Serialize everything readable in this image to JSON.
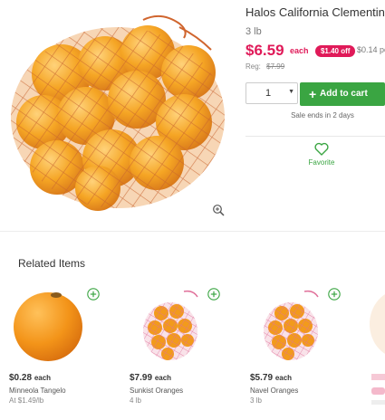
{
  "product": {
    "title": "Halos California Clementines",
    "size": "3 lb",
    "price": "$6.59",
    "each_label": "each",
    "discount_badge": "$1.40 off",
    "unit_price": "$0.14 pe",
    "reg_label": "Reg:",
    "reg_price": "$7.99",
    "quantity": "1",
    "add_to_cart_label": "Add to cart",
    "sale_note": "Sale ends in 2 days",
    "favorite_label": "Favorite"
  },
  "related": {
    "title": "Related Items",
    "items": [
      {
        "price": "$0.28",
        "each": "each",
        "name": "Minneola Tangelo",
        "sub": "At $1.49/lb"
      },
      {
        "price": "$7.99",
        "each": "each",
        "name": "Sunkist Oranges",
        "sub": "4 lb"
      },
      {
        "price": "$5.79",
        "each": "each",
        "name": "Navel Oranges",
        "sub": "3 lb"
      }
    ]
  },
  "colors": {
    "sale_pink": "#e01a59",
    "action_green": "#3aa542"
  },
  "icons": [
    "zoom-in-icon",
    "heart-icon",
    "plus-circle-icon",
    "chevron-down-icon"
  ]
}
